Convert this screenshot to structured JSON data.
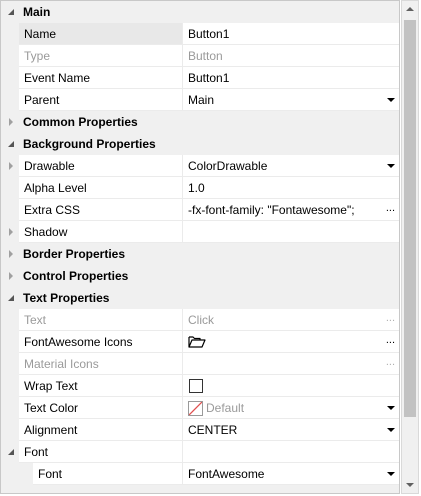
{
  "sections": {
    "main": "Main",
    "common": "Common Properties",
    "background": "Background Properties",
    "border": "Border Properties",
    "control": "Control Properties",
    "text": "Text Properties",
    "font": "Font"
  },
  "rows": {
    "name": {
      "label": "Name",
      "value": "Button1"
    },
    "type": {
      "label": "Type",
      "value": "Button"
    },
    "event_name": {
      "label": "Event Name",
      "value": "Button1"
    },
    "parent": {
      "label": "Parent",
      "value": "Main"
    },
    "drawable": {
      "label": "Drawable",
      "value": "ColorDrawable"
    },
    "alpha": {
      "label": "Alpha Level",
      "value": "1.0"
    },
    "extra_css": {
      "label": "Extra CSS",
      "value": "-fx-font-family: \"Fontawesome\";"
    },
    "shadow": {
      "label": "Shadow",
      "value": ""
    },
    "text": {
      "label": "Text",
      "value": "Click"
    },
    "fa_icons": {
      "label": "FontAwesome Icons",
      "value": ""
    },
    "material_icons": {
      "label": "Material Icons",
      "value": ""
    },
    "wrap_text": {
      "label": "Wrap Text",
      "checked": false
    },
    "text_color": {
      "label": "Text Color",
      "value": "Default"
    },
    "alignment": {
      "label": "Alignment",
      "value": "CENTER"
    },
    "font": {
      "label": "Font",
      "value": "FontAwesome"
    }
  },
  "ellipsis": "...",
  "icons": {
    "expanded": "triangle-expanded-icon",
    "collapsed": "triangle-collapsed-icon",
    "dropdown": "chevron-down-icon",
    "folder": "folder-open-icon",
    "no_color": "no-color-swatch-icon"
  }
}
